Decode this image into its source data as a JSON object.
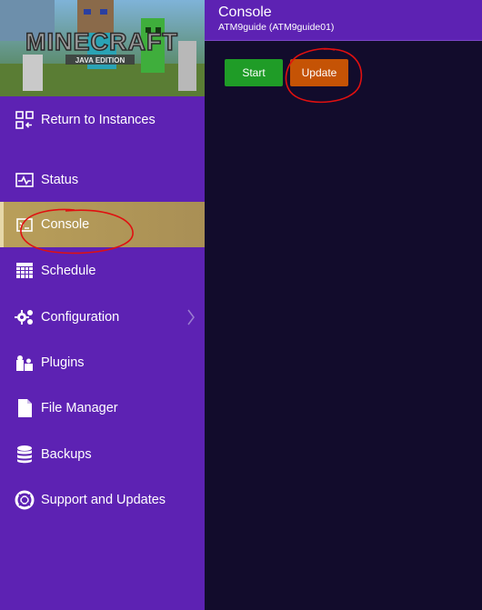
{
  "header": {
    "title": "Console",
    "subtitle": "ATM9guide (ATM9guide01)"
  },
  "banner": {
    "logo_text": "MINECRAFT",
    "edition_text": "JAVA EDITION"
  },
  "sidebar": {
    "items": [
      {
        "label": "Return to Instances",
        "icon": "grid-return-icon"
      },
      {
        "label": "Status",
        "icon": "status-monitor-icon"
      },
      {
        "label": "Console",
        "icon": "console-icon",
        "active": true
      },
      {
        "label": "Schedule",
        "icon": "calendar-icon"
      },
      {
        "label": "Configuration",
        "icon": "gears-icon",
        "has_submenu": true
      },
      {
        "label": "Plugins",
        "icon": "puzzle-icon"
      },
      {
        "label": "File Manager",
        "icon": "file-icon"
      },
      {
        "label": "Backups",
        "icon": "database-icon"
      },
      {
        "label": "Support and Updates",
        "icon": "lifebuoy-icon"
      }
    ]
  },
  "actions": {
    "start_label": "Start",
    "update_label": "Update"
  },
  "colors": {
    "sidebar_bg": "#5d22b3",
    "main_bg": "#120c2c",
    "active_item": "#b99f5a",
    "start_button": "#1f9c27",
    "update_button": "#c55305",
    "annotation": "#e01010"
  }
}
